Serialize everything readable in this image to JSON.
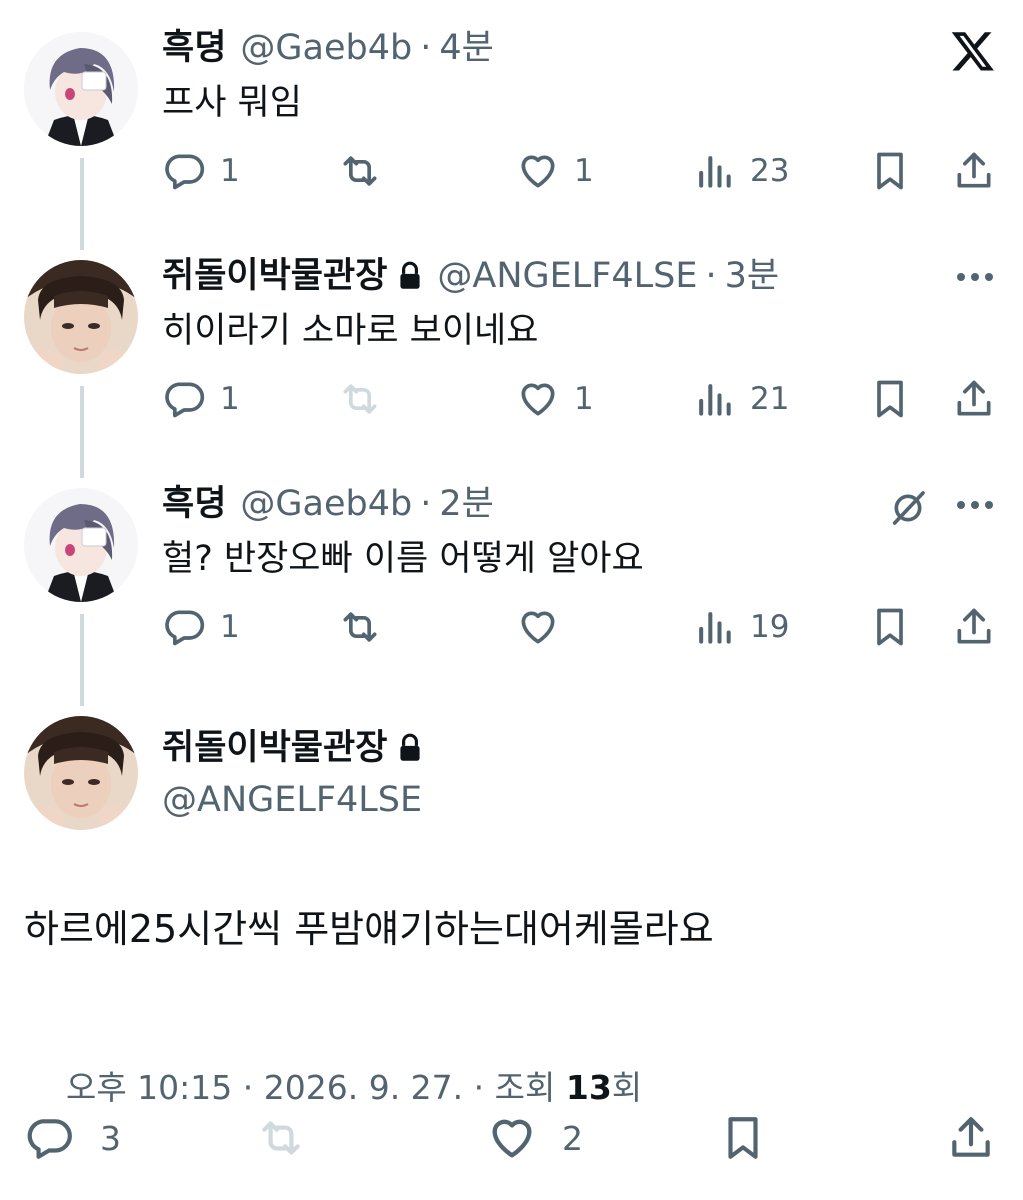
{
  "brand": {
    "logo_icon": "x-logo-icon"
  },
  "colors": {
    "text": "#0f1419",
    "secondary": "#536471",
    "thread_line": "#cfd9de",
    "retweet_disabled": "#cfd9de"
  },
  "posts": [
    {
      "name": "흑뎡",
      "handle": "@Gaeb4b",
      "sep": "·",
      "time": "4분",
      "text": "프사 뭐임",
      "replies": "1",
      "likes": "1",
      "views": "23"
    },
    {
      "name": "쥐돌이박물관장",
      "handle": "@ANGELF4LSE",
      "sep": "·",
      "time": "3분",
      "text": "히이라기 소마로 보이네요",
      "replies": "1",
      "likes": "1",
      "views": "21"
    },
    {
      "name": "흑뎡",
      "handle": "@Gaeb4b",
      "sep": "·",
      "time": "2분",
      "text": "헐? 반장오빠 이름 어떻게 알아요",
      "replies": "1",
      "likes": "",
      "views": "19"
    }
  ],
  "main": {
    "name": "쥐돌이박물관장",
    "handle": "@ANGELF4LSE",
    "text": "하르에25시간씩 푸밤얘기하는대어케몰라요",
    "meta_prefix": "오후 10:15 · 2026. 9. 27. · 조회 ",
    "views": "13",
    "views_suffix": "회",
    "replies": "3",
    "likes": "2"
  }
}
